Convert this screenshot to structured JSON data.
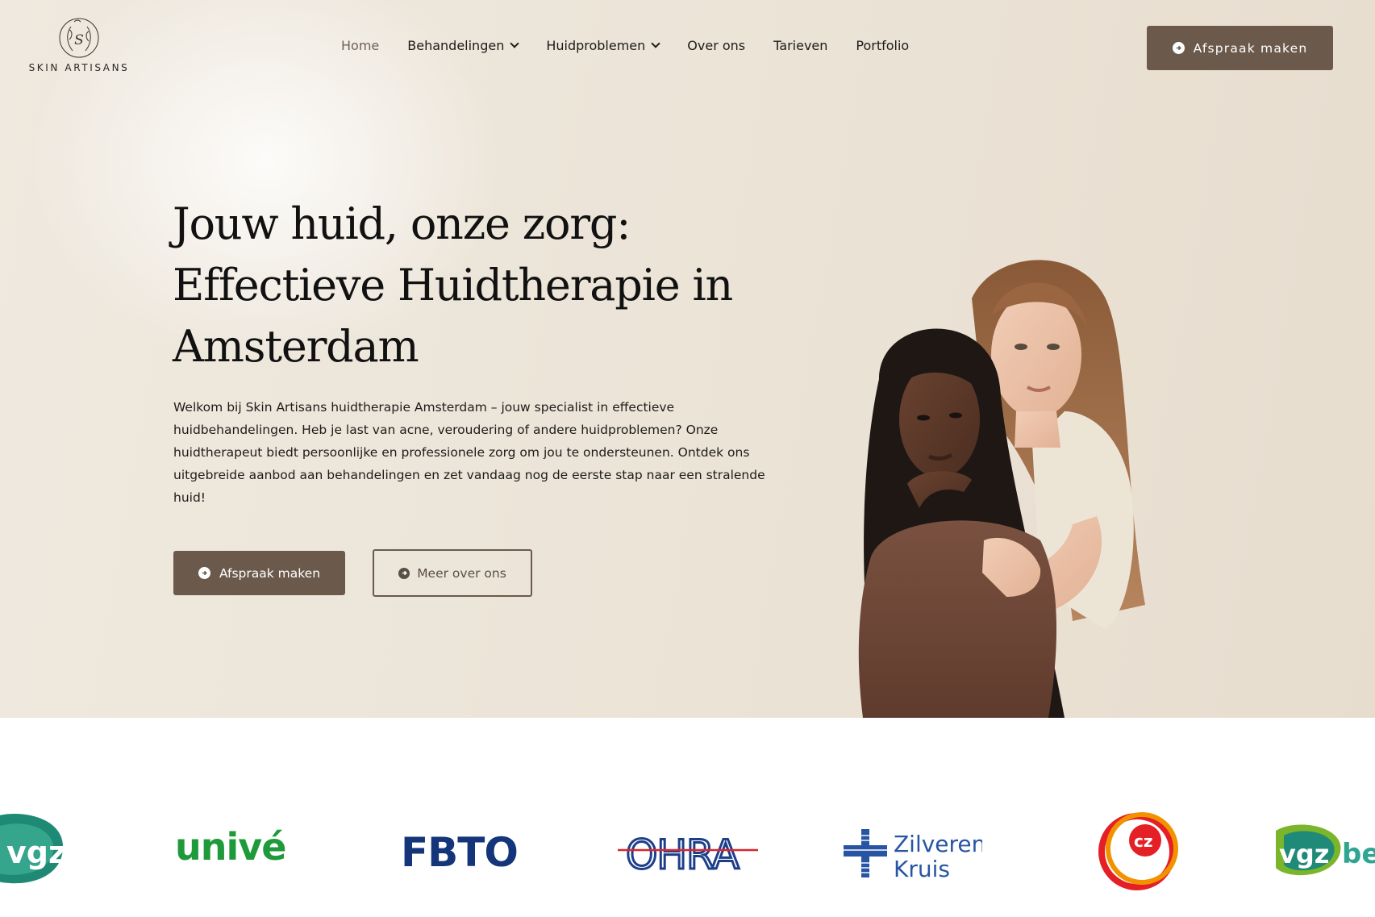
{
  "brand": {
    "name": "SKIN ARTISANS"
  },
  "nav": {
    "items": [
      {
        "label": "Home",
        "active": true,
        "dropdown": false
      },
      {
        "label": "Behandelingen",
        "active": false,
        "dropdown": true
      },
      {
        "label": "Huidproblemen",
        "active": false,
        "dropdown": true
      },
      {
        "label": "Over ons",
        "active": false,
        "dropdown": false
      },
      {
        "label": "Tarieven",
        "active": false,
        "dropdown": false
      },
      {
        "label": "Portfolio",
        "active": false,
        "dropdown": false
      }
    ],
    "cta_label": "Afspraak maken"
  },
  "hero": {
    "headline_line1": "Jouw huid, onze zorg:",
    "headline_line2": "Effectieve Huidtherapie in",
    "headline_line3": "Amsterdam",
    "intro": "Welkom bij Skin Artisans huidtherapie Amsterdam – jouw specialist in effectieve huidbehandelingen. Heb je last van acne, veroudering of andere huidproblemen? Onze huidtherapeut biedt persoonlijke en professionele zorg om jou te ondersteunen. Ontdek ons uitgebreide aanbod aan behandelingen en zet vandaag nog de eerste stap naar een stralende huid!",
    "primary_button": "Afspraak maken",
    "secondary_button": "Meer over ons"
  },
  "partners": {
    "logos": [
      {
        "name": "vgz",
        "text": "vgz"
      },
      {
        "name": "unive",
        "text": "univé"
      },
      {
        "name": "fbto",
        "text": "FBTO"
      },
      {
        "name": "ohra",
        "text": "OHRA"
      },
      {
        "name": "zilveren-kruis",
        "line1": "Zilveren",
        "line2": "Kruis"
      },
      {
        "name": "cz",
        "text": "cz"
      },
      {
        "name": "vgz-bewuzt",
        "text": "vgz",
        "suffix": "be"
      }
    ]
  },
  "colors": {
    "accent": "#6b5a4c",
    "hero_bg": "#ebe3d6",
    "unive_green": "#1f9a3a",
    "unive_red": "#e8473c",
    "fbto_blue": "#14357a",
    "ohra_blue": "#1d3f8a",
    "ohra_red": "#d8262f",
    "zk_blue": "#2855a3",
    "cz_red": "#e41f26",
    "cz_orange": "#f39200"
  }
}
